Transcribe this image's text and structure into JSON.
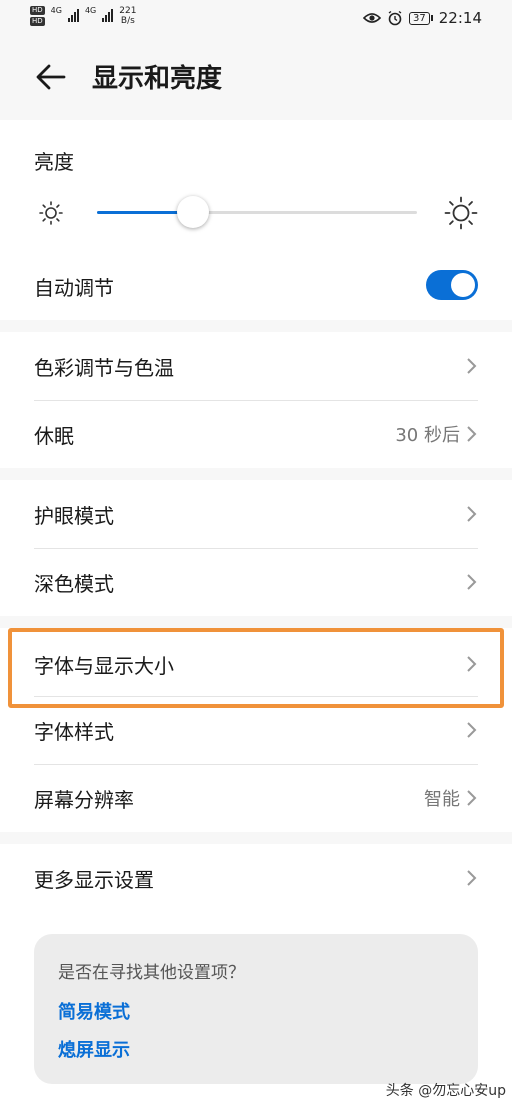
{
  "status_bar": {
    "hd1": "HD",
    "hd2": "HD",
    "net1": "4G",
    "net2": "4G",
    "speed_value": "221",
    "speed_unit": "B/s",
    "battery": "37",
    "time": "22:14"
  },
  "header": {
    "title": "显示和亮度"
  },
  "brightness": {
    "label": "亮度",
    "level": 0.3
  },
  "auto_adjust": {
    "label": "自动调节",
    "enabled": true
  },
  "group1": [
    {
      "label": "色彩调节与色温",
      "value": ""
    },
    {
      "label": "休眠",
      "value": "30 秒后"
    }
  ],
  "group2": [
    {
      "label": "护眼模式",
      "value": ""
    },
    {
      "label": "深色模式",
      "value": ""
    }
  ],
  "group3": [
    {
      "label": "字体与显示大小",
      "value": ""
    },
    {
      "label": "字体样式",
      "value": ""
    },
    {
      "label": "屏幕分辨率",
      "value": "智能"
    }
  ],
  "group4": [
    {
      "label": "更多显示设置",
      "value": ""
    }
  ],
  "suggestion": {
    "question": "是否在寻找其他设置项？",
    "links": [
      "简易模式",
      "熄屏显示"
    ]
  },
  "watermark": "头条 @勿忘心安up",
  "colors": {
    "accent": "#0a6fd6",
    "highlight": "#f0923a"
  }
}
